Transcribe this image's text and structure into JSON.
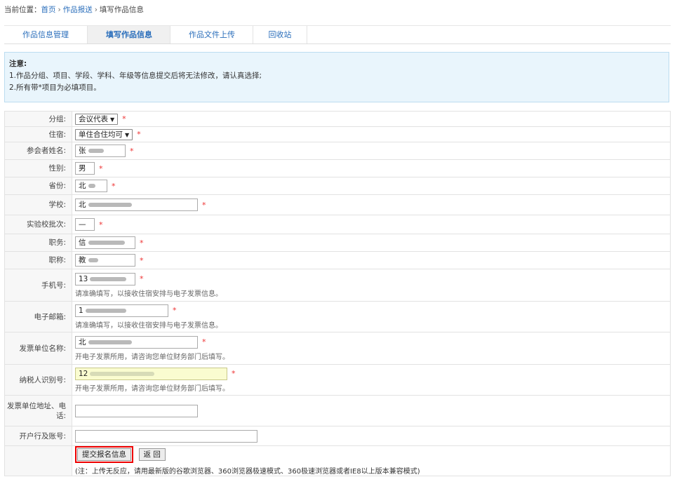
{
  "breadcrumb": {
    "prefix": "当前位置：",
    "home": "首页",
    "sep": "›",
    "section": "作品报送",
    "current": "填写作品信息"
  },
  "tabs": [
    {
      "label": "作品信息管理",
      "active": false
    },
    {
      "label": "填写作品信息",
      "active": true
    },
    {
      "label": "作品文件上传",
      "active": false
    },
    {
      "label": "回收站",
      "active": false
    }
  ],
  "notice": {
    "title": "注意:",
    "line1": "1.作品分组、项目、学段、学科、年级等信息提交后将无法修改，请认真选择;",
    "line2": "2.所有带*项目为必填项目。"
  },
  "form": {
    "required_mark": "*",
    "group": {
      "label": "分组:",
      "value": "会议代表"
    },
    "lodging": {
      "label": "住宿:",
      "value": "单住合住均可"
    },
    "name": {
      "label": "参会者姓名:",
      "value": "张"
    },
    "gender": {
      "label": "性别:",
      "value": "男"
    },
    "province": {
      "label": "省份:",
      "value": "北"
    },
    "school": {
      "label": "学校:",
      "value": "北"
    },
    "batch": {
      "label": "实验校批次:",
      "value": "—"
    },
    "duty": {
      "label": "职务:",
      "value": "信"
    },
    "title": {
      "label": "职称:",
      "value": "教"
    },
    "mobile": {
      "label": "手机号:",
      "value": "13",
      "hint": "请准确填写，以接收住宿安排与电子发票信息。"
    },
    "email": {
      "label": "电子邮箱:",
      "value": "1",
      "hint": "请准确填写，以接收住宿安排与电子发票信息。"
    },
    "invoice_unit": {
      "label": "发票单位名称:",
      "value": "北",
      "hint": "开电子发票所用，请咨询您单位财务部门后填写。"
    },
    "tax_id": {
      "label": "纳税人识别号:",
      "value": "12",
      "hint": "开电子发票所用，请咨询您单位财务部门后填写。"
    },
    "invoice_addr": {
      "label": "发票单位地址、电话:",
      "value": ""
    },
    "bank": {
      "label": "开户行及账号:",
      "value": ""
    }
  },
  "actions": {
    "submit": "提交报名信息",
    "back": "返 回",
    "note": "(注：上传无反应，请用最新版的谷歌浏览器、360浏览器极速模式、360极速浏览器或者IE8以上版本兼容模式)"
  },
  "colors": {
    "link": "#2a6ebb",
    "notice_bg": "#e9f5fc",
    "required": "#e33",
    "submit_outline": "#e00"
  }
}
